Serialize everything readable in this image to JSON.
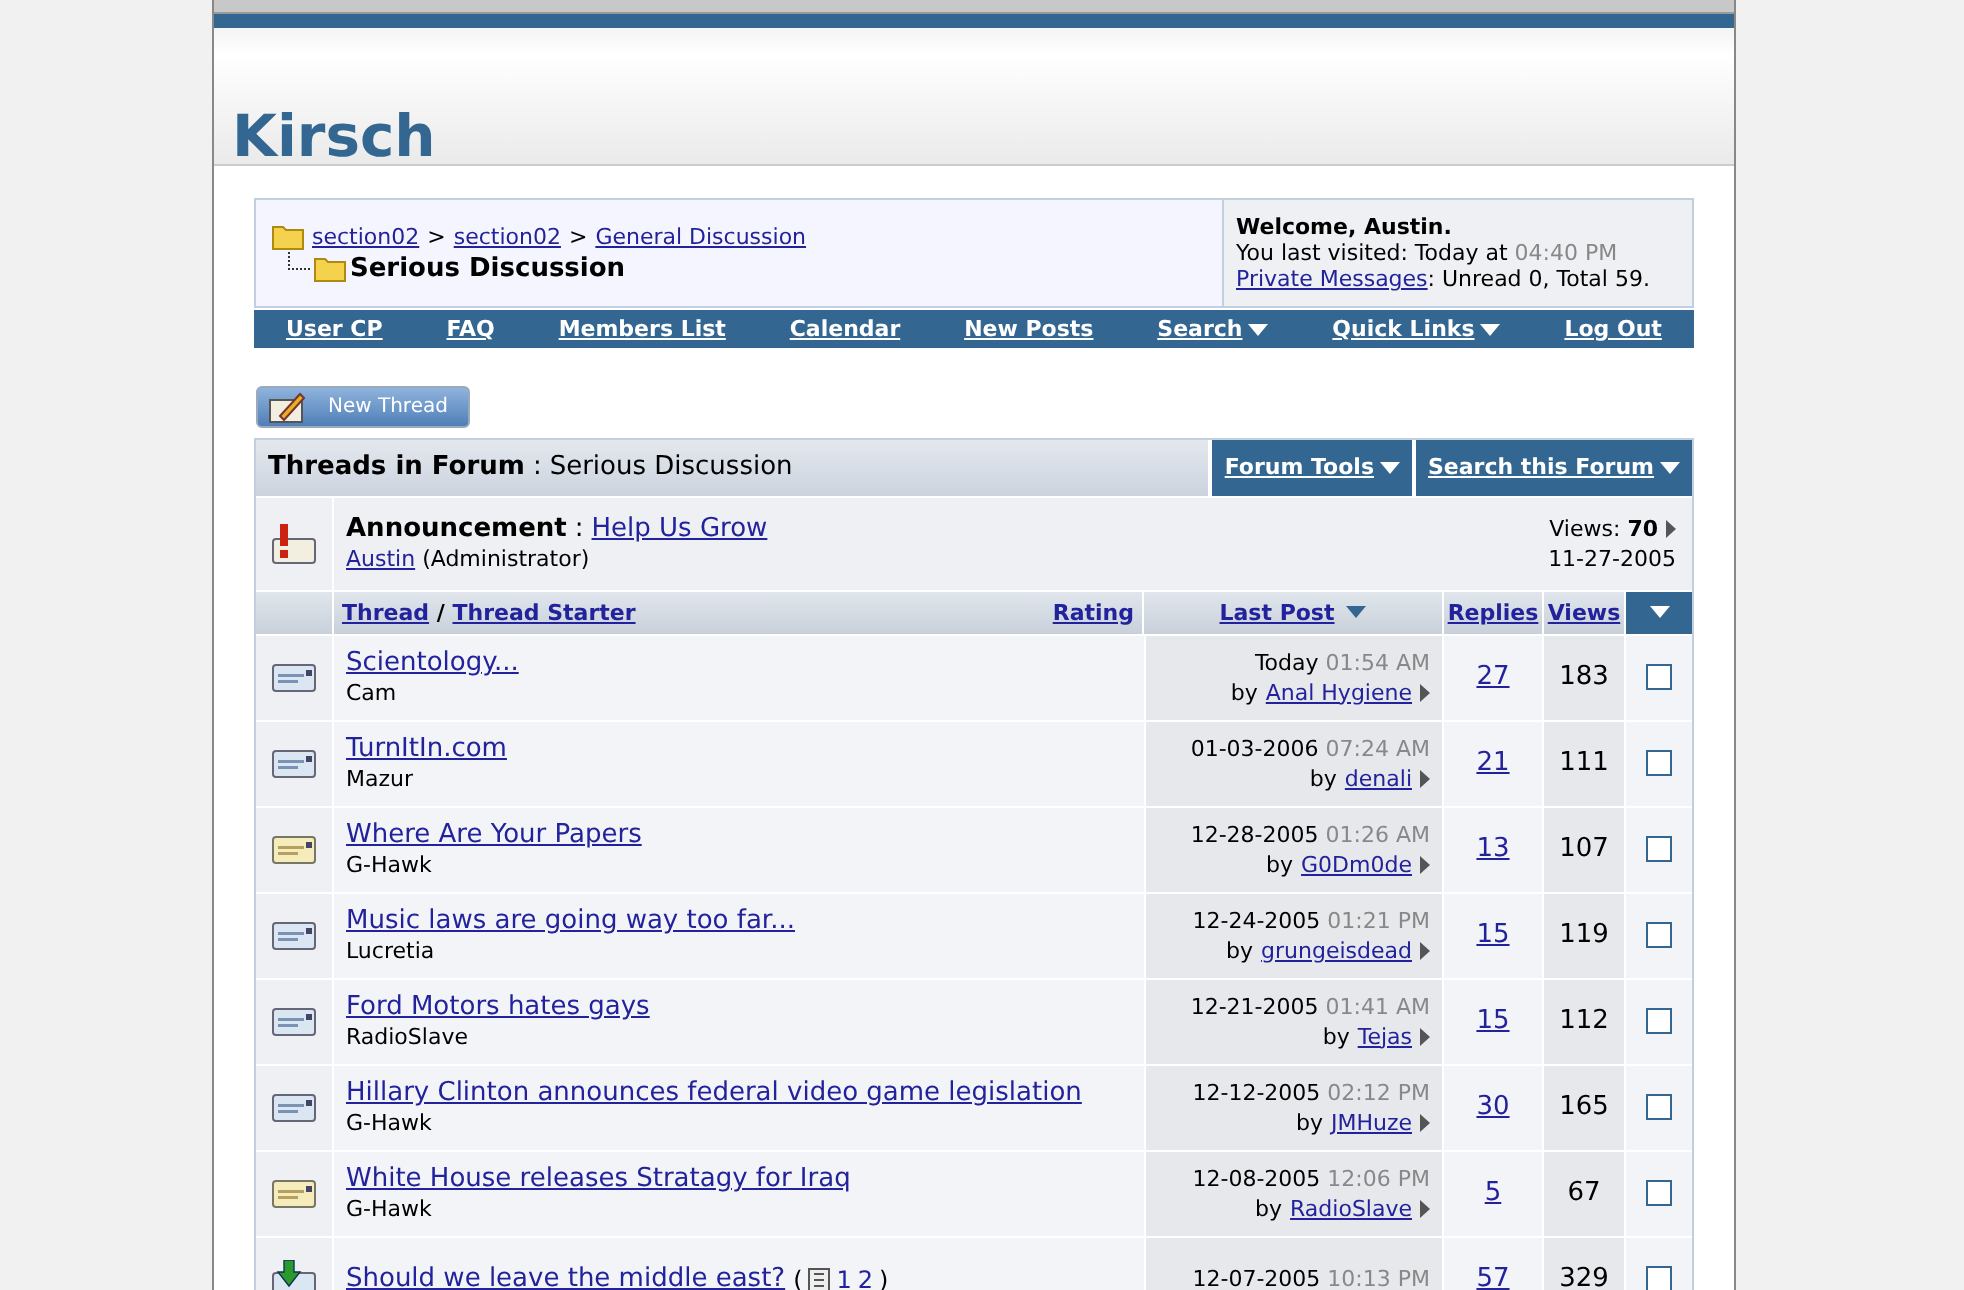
{
  "site": {
    "title": "Kirsch"
  },
  "breadcrumb": {
    "links": [
      "section02",
      "section02",
      "General Discussion"
    ],
    "separator": ">",
    "current": "Serious Discussion"
  },
  "welcome": {
    "greeting": "Welcome, Austin.",
    "last_visited_label": "You last visited: Today at",
    "last_visited_time": "04:40 PM",
    "pm_link": "Private Messages",
    "pm_counts": ": Unread 0, Total 59."
  },
  "navbar": [
    {
      "label": "User CP",
      "menu": false
    },
    {
      "label": "FAQ",
      "menu": false
    },
    {
      "label": "Members List",
      "menu": false
    },
    {
      "label": "Calendar",
      "menu": false
    },
    {
      "label": "New Posts",
      "menu": false
    },
    {
      "label": "Search",
      "menu": true
    },
    {
      "label": "Quick Links",
      "menu": true
    },
    {
      "label": "Log Out",
      "menu": false
    }
  ],
  "new_thread_button": "New Thread",
  "forum_header": {
    "title": "Threads in Forum",
    "separator": ":",
    "forum": "Serious Discussion",
    "tools": [
      "Forum Tools",
      "Search this Forum"
    ]
  },
  "announcement": {
    "label": "Announcement",
    "separator": ":",
    "title": "Help Us Grow",
    "author": "Austin",
    "role": "(Administrator)",
    "views_label": "Views:",
    "views": "70",
    "date": "11-27-2005"
  },
  "columns": {
    "thread": "Thread",
    "slash": "/",
    "starter": "Thread Starter",
    "rating": "Rating",
    "last_post": "Last Post",
    "replies": "Replies",
    "views": "Views"
  },
  "threads": [
    {
      "kind": "plain",
      "title": "Scientology...",
      "starter": "Cam",
      "date": "Today",
      "time": "01:54 AM",
      "by": "by",
      "last_poster": "Anal Hygiene",
      "replies": "27",
      "views": "183",
      "checked": false
    },
    {
      "kind": "plain",
      "title": "TurnItIn.com",
      "starter": "Mazur",
      "date": "01-03-2006",
      "time": "07:24 AM",
      "by": "by",
      "last_poster": "denali",
      "replies": "21",
      "views": "111",
      "checked": false
    },
    {
      "kind": "hot",
      "title": "Where Are Your Papers",
      "starter": "G-Hawk",
      "date": "12-28-2005",
      "time": "01:26 AM",
      "by": "by",
      "last_poster": "G0Dm0de",
      "replies": "13",
      "views": "107",
      "checked": false
    },
    {
      "kind": "plain",
      "title": "Music laws are going way too far...",
      "starter": "Lucretia",
      "date": "12-24-2005",
      "time": "01:21 PM",
      "by": "by",
      "last_poster": "grungeisdead",
      "replies": "15",
      "views": "119",
      "checked": false
    },
    {
      "kind": "plain",
      "title": "Ford Motors hates gays",
      "starter": "RadioSlave",
      "date": "12-21-2005",
      "time": "01:41 AM",
      "by": "by",
      "last_poster": "Tejas",
      "replies": "15",
      "views": "112",
      "checked": false
    },
    {
      "kind": "plain",
      "title": "Hillary Clinton announces federal video game legislation",
      "starter": "G-Hawk",
      "date": "12-12-2005",
      "time": "02:12 PM",
      "by": "by",
      "last_poster": "JMHuze",
      "replies": "30",
      "views": "165",
      "checked": false
    },
    {
      "kind": "hot",
      "title": "White House releases Stratagy for Iraq",
      "starter": "G-Hawk",
      "date": "12-08-2005",
      "time": "12:06 PM",
      "by": "by",
      "last_poster": "RadioSlave",
      "replies": "5",
      "views": "67",
      "checked": false
    },
    {
      "kind": "arrow",
      "title": "Should we leave the middle east?",
      "pages_open": "(",
      "pages": [
        "1",
        "2"
      ],
      "pages_close": ")",
      "date": "12-07-2005",
      "time": "10:13 PM",
      "replies": "57",
      "views": "329",
      "checked": false
    }
  ]
}
